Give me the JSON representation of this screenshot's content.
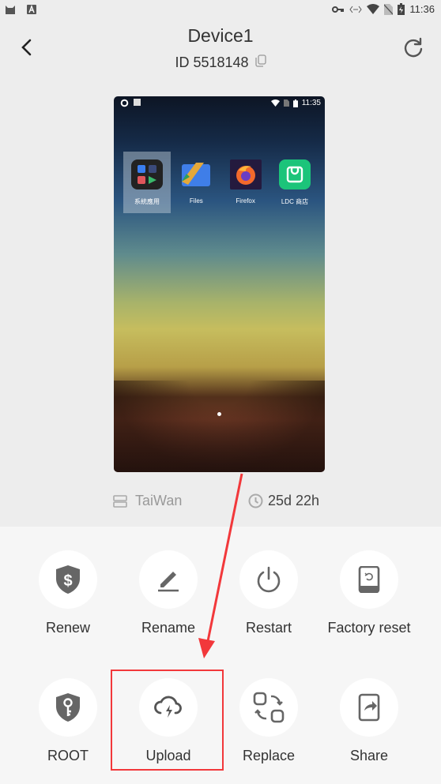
{
  "status_bar": {
    "left_icons": [
      "cat-app-icon",
      "a-notification-icon"
    ],
    "right_icons": [
      "vpn-key-icon",
      "data-arrows-icon",
      "wifi-icon",
      "no-sim-icon",
      "battery-charging-icon"
    ],
    "time": "11:36"
  },
  "header": {
    "title": "Device1",
    "id_label": "ID 5518148",
    "back_icon": "chevron-left-icon",
    "refresh_icon": "refresh-icon",
    "copy_icon": "copy-icon"
  },
  "device_screen": {
    "status_time": "11:35",
    "apps": [
      {
        "label": "系統應用",
        "icon": "folder-system-apps-icon",
        "selected": true
      },
      {
        "label": "Files",
        "icon": "files-icon",
        "selected": false
      },
      {
        "label": "Firefox",
        "icon": "firefox-icon",
        "selected": false
      },
      {
        "label": "LDC 商店",
        "icon": "ldc-store-icon",
        "selected": false
      }
    ]
  },
  "info": {
    "region": "TaiWan",
    "remaining_time": "25d 22h"
  },
  "actions": [
    {
      "label": "Renew",
      "icon": "shield-dollar-icon"
    },
    {
      "label": "Rename",
      "icon": "pencil-icon"
    },
    {
      "label": "Restart",
      "icon": "power-icon"
    },
    {
      "label": "Factory reset",
      "icon": "tablet-reset-icon"
    },
    {
      "label": "ROOT",
      "icon": "shield-key-icon"
    },
    {
      "label": "Upload",
      "icon": "cloud-upload-icon"
    },
    {
      "label": "Replace",
      "icon": "replace-icon"
    },
    {
      "label": "Share",
      "icon": "share-icon"
    }
  ],
  "annotation": {
    "color": "#f2383b",
    "target": "Upload"
  }
}
